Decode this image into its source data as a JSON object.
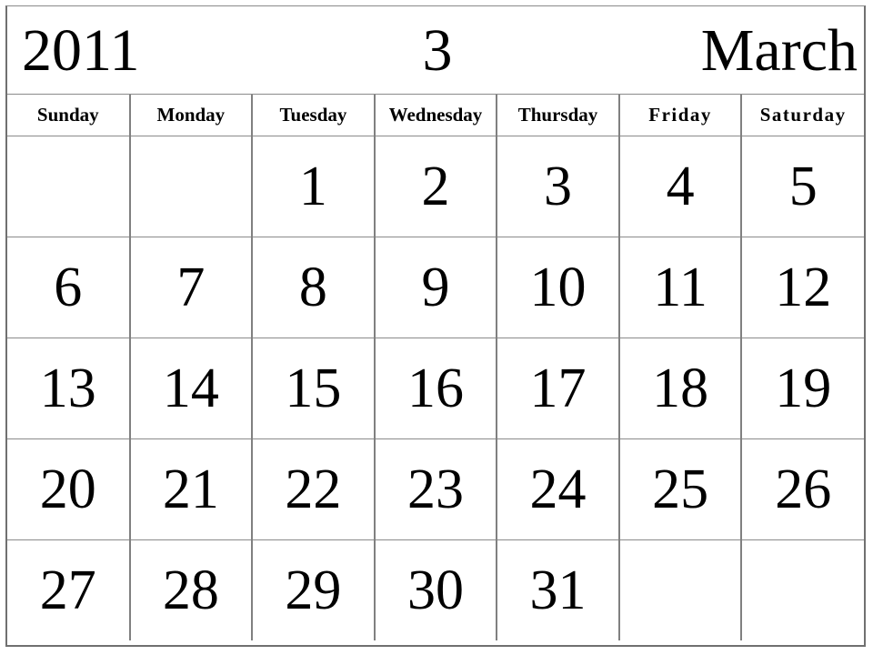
{
  "calendar": {
    "title": {
      "year": "2011",
      "month_number": "3",
      "month_name": "March"
    },
    "day_headers": [
      "Sunday",
      "Monday",
      "Tuesday",
      "Wednesday",
      "Thursday",
      "Friday",
      "Saturday"
    ],
    "weeks": [
      {
        "days": [
          "",
          "",
          "1",
          "2",
          "3",
          "4",
          "5"
        ]
      },
      {
        "days": [
          "6",
          "7",
          "8",
          "9",
          "10",
          "11",
          "12"
        ]
      },
      {
        "days": [
          "13",
          "14",
          "15",
          "16",
          "17",
          "18",
          "19"
        ]
      },
      {
        "days": [
          "20",
          "21",
          "22",
          "23",
          "24",
          "25",
          "26"
        ]
      },
      {
        "days": [
          "27",
          "28",
          "29",
          "30",
          "31",
          "",
          ""
        ]
      }
    ],
    "colors": {
      "background": "#ffffff",
      "text": "#000000",
      "grid_line": "#808080",
      "border": "#707070"
    }
  }
}
